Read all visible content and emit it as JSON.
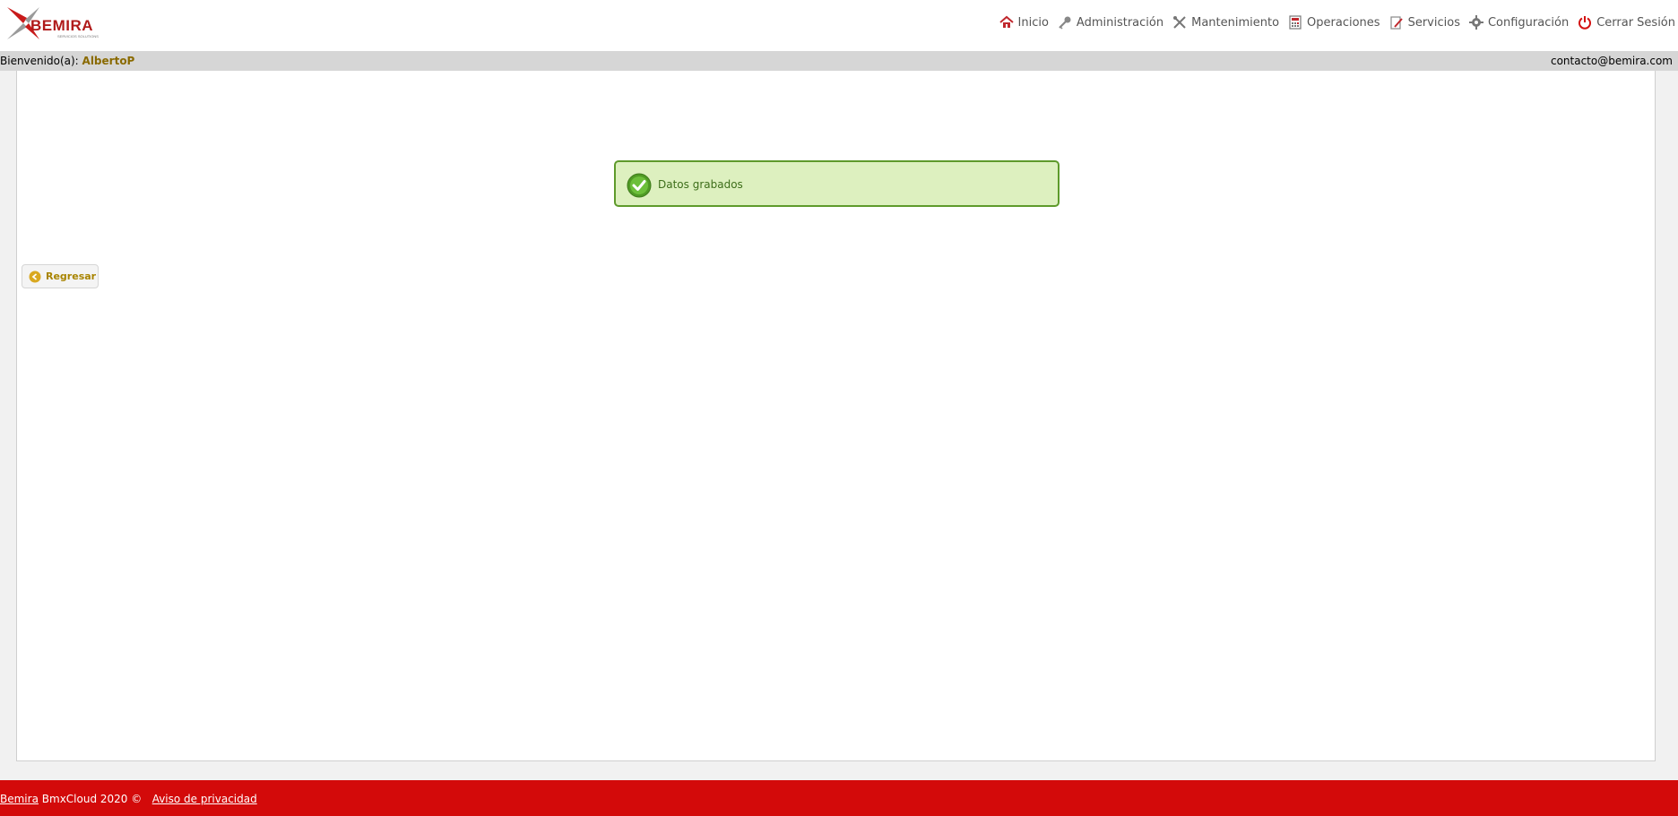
{
  "header": {
    "logo_text": "BEMIRA",
    "logo_tagline": "SERVICIOS SOLUTIONS",
    "nav": [
      {
        "label": "Inicio",
        "icon": "home-icon"
      },
      {
        "label": "Administración",
        "icon": "key-icon"
      },
      {
        "label": "Mantenimiento",
        "icon": "tools-icon"
      },
      {
        "label": "Operaciones",
        "icon": "calculator-icon"
      },
      {
        "label": "Servicios",
        "icon": "document-pen-icon"
      },
      {
        "label": "Configuración",
        "icon": "gear-icon"
      },
      {
        "label": "Cerrar Sesión",
        "icon": "power-icon"
      }
    ]
  },
  "welcome": {
    "prefix": "Bienvenido(a):",
    "user": "AlbertoP",
    "contact": "contacto@bemira.com"
  },
  "alert": {
    "message": "Datos grabados",
    "type": "success"
  },
  "back_button": {
    "label": "Regresar"
  },
  "footer": {
    "brand_link": "Bemira",
    "text": "BmxCloud 2020 ©",
    "privacy_link": "Aviso de privacidad"
  },
  "colors": {
    "accent_red": "#d30a0a",
    "success_bg": "#ddf0bf",
    "success_border": "#5e9a2b",
    "username": "#8a6a00"
  }
}
